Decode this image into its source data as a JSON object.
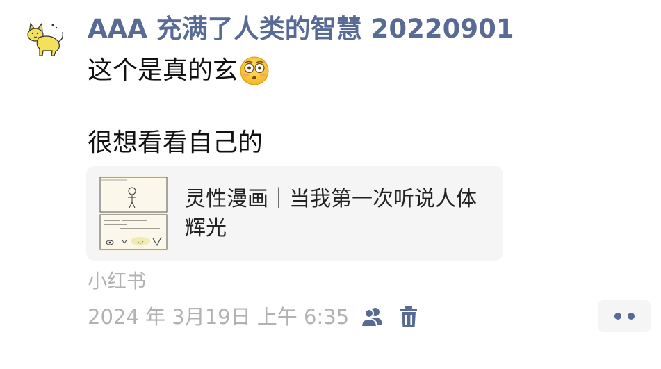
{
  "post": {
    "username": "AAA 充满了人类的智慧 20220901",
    "line1_text": "这个是真的玄",
    "line1_emoji": "flushed-face-emoji",
    "line2_text": "很想看看自己的"
  },
  "link_card": {
    "title": "灵性漫画｜当我第一次听说人体辉光",
    "thumbnail_icon": "comic-thumbnail"
  },
  "source": "小红书",
  "meta": {
    "timestamp": "2024 年 3月19日 上午 6:35",
    "visibility_icon": "friends-icon",
    "delete_icon": "trash-icon"
  },
  "more_button_icon": "more-dots-icon",
  "colors": {
    "username": "#576b95",
    "text": "#111111",
    "meta": "#b2b2b2",
    "card_bg": "#f5f5f5",
    "avatar_cat": "#f4e05a"
  }
}
